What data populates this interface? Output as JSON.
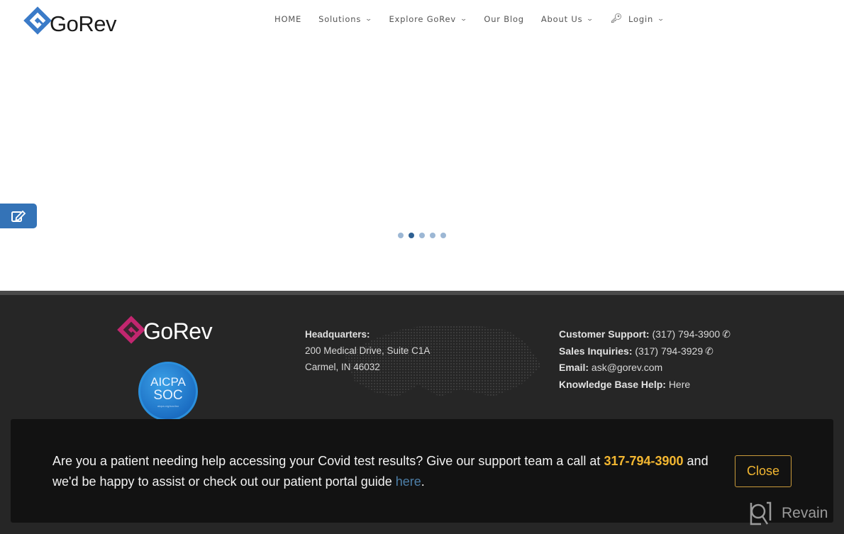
{
  "header": {
    "logo_text": "GoRev",
    "logo_icon": "gorev-diamond-logo-icon",
    "brand_color": "#3b7bc8",
    "nav": [
      {
        "label": "HOME",
        "has_dropdown": false
      },
      {
        "label": "Solutions",
        "has_dropdown": true
      },
      {
        "label": "Explore GoRev",
        "has_dropdown": true
      },
      {
        "label": "Our Blog",
        "has_dropdown": false
      },
      {
        "label": "About Us",
        "has_dropdown": true
      },
      {
        "label": "Login",
        "has_dropdown": true,
        "icon": "key-icon"
      }
    ]
  },
  "hero": {
    "feedback_icon": "edit-icon",
    "carousel": {
      "count": 5,
      "active_index": 1
    }
  },
  "footer": {
    "logo_text": "GoRev",
    "logo_color": "#c2266f",
    "badge": {
      "line1": "AICPA",
      "line2": "SOC",
      "line3": "aicpa.org/soc4so"
    },
    "headquarters": {
      "label": "Headquarters:",
      "address1": "200 Medical Drive, Suite C1A",
      "address2": "Carmel, IN 46032"
    },
    "contact": {
      "support_label": "Customer Support:",
      "support_phone": "(317) 794-3900",
      "sales_label": "Sales Inquiries:",
      "sales_phone": "(317) 794-3929",
      "email_label": "Email:",
      "email": "ask@gorev.com",
      "kb_label": "Knowledge Base Help:",
      "kb_link": "Here"
    }
  },
  "banner": {
    "text_before": "Are you a patient needing help accessing your Covid test results? Give our support team a call at ",
    "phone": "317-794-3900",
    "text_after": " and we'd be happy to assist or check out our patient portal guide ",
    "link": "here",
    "end": ".",
    "close_label": "Close",
    "highlight_color": "#f3b731"
  },
  "watermark": {
    "text": "Revain"
  }
}
